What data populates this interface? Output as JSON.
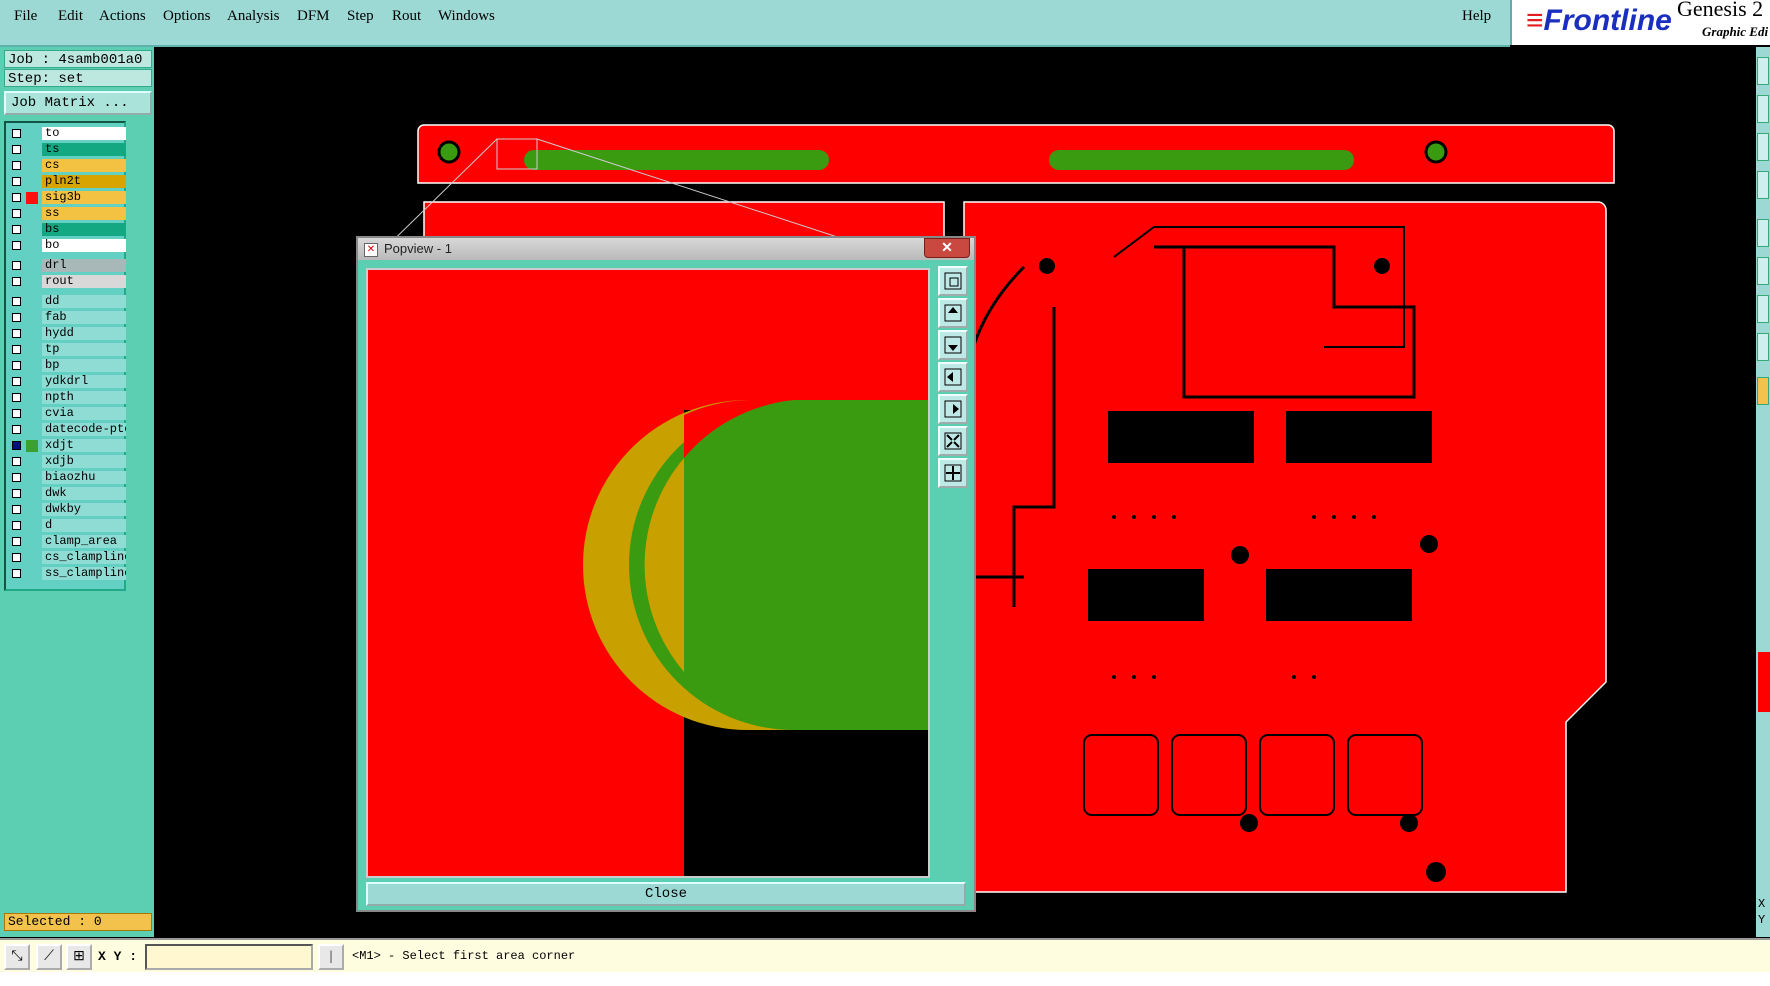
{
  "menubar": {
    "items": [
      "File",
      "Edit",
      "Actions",
      "Options",
      "Analysis",
      "DFM",
      "Step",
      "Rout",
      "Windows"
    ],
    "help": "Help"
  },
  "brand": {
    "logo": "Frontline",
    "product": "Genesis 2",
    "subtitle": "Graphic Edi"
  },
  "job": {
    "label": "Job : 4samb001a0",
    "step": "Step: set",
    "matrix_button": "Job Matrix ..."
  },
  "layers": [
    {
      "name": "to",
      "color": "#ffffff"
    },
    {
      "name": "ts",
      "color": "#14a882"
    },
    {
      "name": "cs",
      "color": "#f4c242"
    },
    {
      "name": "pln2t",
      "color": "#d8a400"
    },
    {
      "name": "sig3b",
      "color": "#f4c242",
      "swatch": "#ff1010"
    },
    {
      "name": "ss",
      "color": "#f4c242"
    },
    {
      "name": "bs",
      "color": "#14a882"
    },
    {
      "name": "bo",
      "color": "#ffffff"
    },
    {
      "name": "drl",
      "color": "#a8b8b8"
    },
    {
      "name": "rout",
      "color": "#d8d8d8"
    },
    {
      "name": "dd",
      "color": "#8fdcd4"
    },
    {
      "name": "fab",
      "color": "#8fdcd4"
    },
    {
      "name": "hydd",
      "color": "#8fdcd4"
    },
    {
      "name": "tp",
      "color": "#8fdcd4"
    },
    {
      "name": "bp",
      "color": "#8fdcd4"
    },
    {
      "name": "ydkdrl",
      "color": "#8fdcd4"
    },
    {
      "name": "npth",
      "color": "#8fdcd4"
    },
    {
      "name": "cvia",
      "color": "#8fdcd4"
    },
    {
      "name": "datecode-pte",
      "color": "#8fdcd4"
    },
    {
      "name": "xdjt",
      "color": "#8fdcd4",
      "swatch": "#3aa030",
      "checked": true
    },
    {
      "name": "xdjb",
      "color": "#8fdcd4"
    },
    {
      "name": "biaozhu",
      "color": "#8fdcd4"
    },
    {
      "name": "dwk",
      "color": "#8fdcd4"
    },
    {
      "name": "dwkby",
      "color": "#8fdcd4"
    },
    {
      "name": "d",
      "color": "#8fdcd4"
    },
    {
      "name": "clamp_area",
      "color": "#8fdcd4"
    },
    {
      "name": "cs_clampline",
      "color": "#8fdcd4"
    },
    {
      "name": "ss_clampline",
      "color": "#8fdcd4"
    }
  ],
  "selected": "Selected : 0",
  "popview": {
    "title": "Popview - 1",
    "close_label": "Close"
  },
  "bottom": {
    "xy_label": "X Y :",
    "xy_value": "",
    "status": "<M1> - Select first area corner"
  },
  "colors": {
    "board": "#ff0000",
    "copper_top": "#3a9a10",
    "paste": "#c8a000",
    "panel": "#5ccfb3"
  },
  "right_readout": {
    "x": "X",
    "y": "Y"
  }
}
